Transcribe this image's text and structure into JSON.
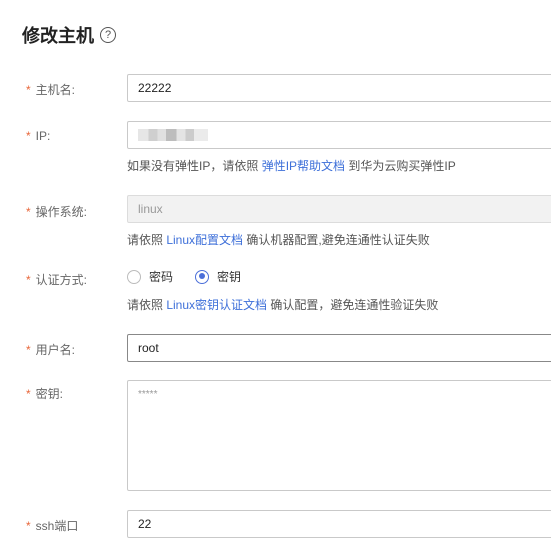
{
  "page": {
    "title": "修改主机",
    "help_icon": "?"
  },
  "form": {
    "required_mark": "*",
    "hostname": {
      "label": "主机名:",
      "value": "22222"
    },
    "ip": {
      "label": "IP:",
      "hint_prefix": "如果没有弹性IP，请依照 ",
      "hint_link": "弹性IP帮助文档",
      "hint_suffix": " 到华为云购买弹性IP"
    },
    "os": {
      "label": "操作系统:",
      "value": "linux",
      "hint_prefix": "请依照 ",
      "hint_link": "Linux配置文档",
      "hint_suffix": " 确认机器配置,避免连通性认证失败"
    },
    "auth": {
      "label": "认证方式:",
      "options": [
        {
          "label": "密码",
          "selected": false
        },
        {
          "label": "密钥",
          "selected": true
        }
      ],
      "hint_prefix": "请依照 ",
      "hint_link": "Linux密钥认证文档",
      "hint_suffix": " 确认配置，避免连通性验证失败"
    },
    "username": {
      "label": "用户名:",
      "value": "root"
    },
    "key": {
      "label": "密钥:",
      "placeholder": "*****"
    },
    "ssh_port": {
      "label": "ssh端口",
      "value": "22"
    }
  },
  "colors": {
    "required": "#e8663a",
    "link": "#3d6fd9",
    "radio_accent": "#4b6fd9"
  }
}
